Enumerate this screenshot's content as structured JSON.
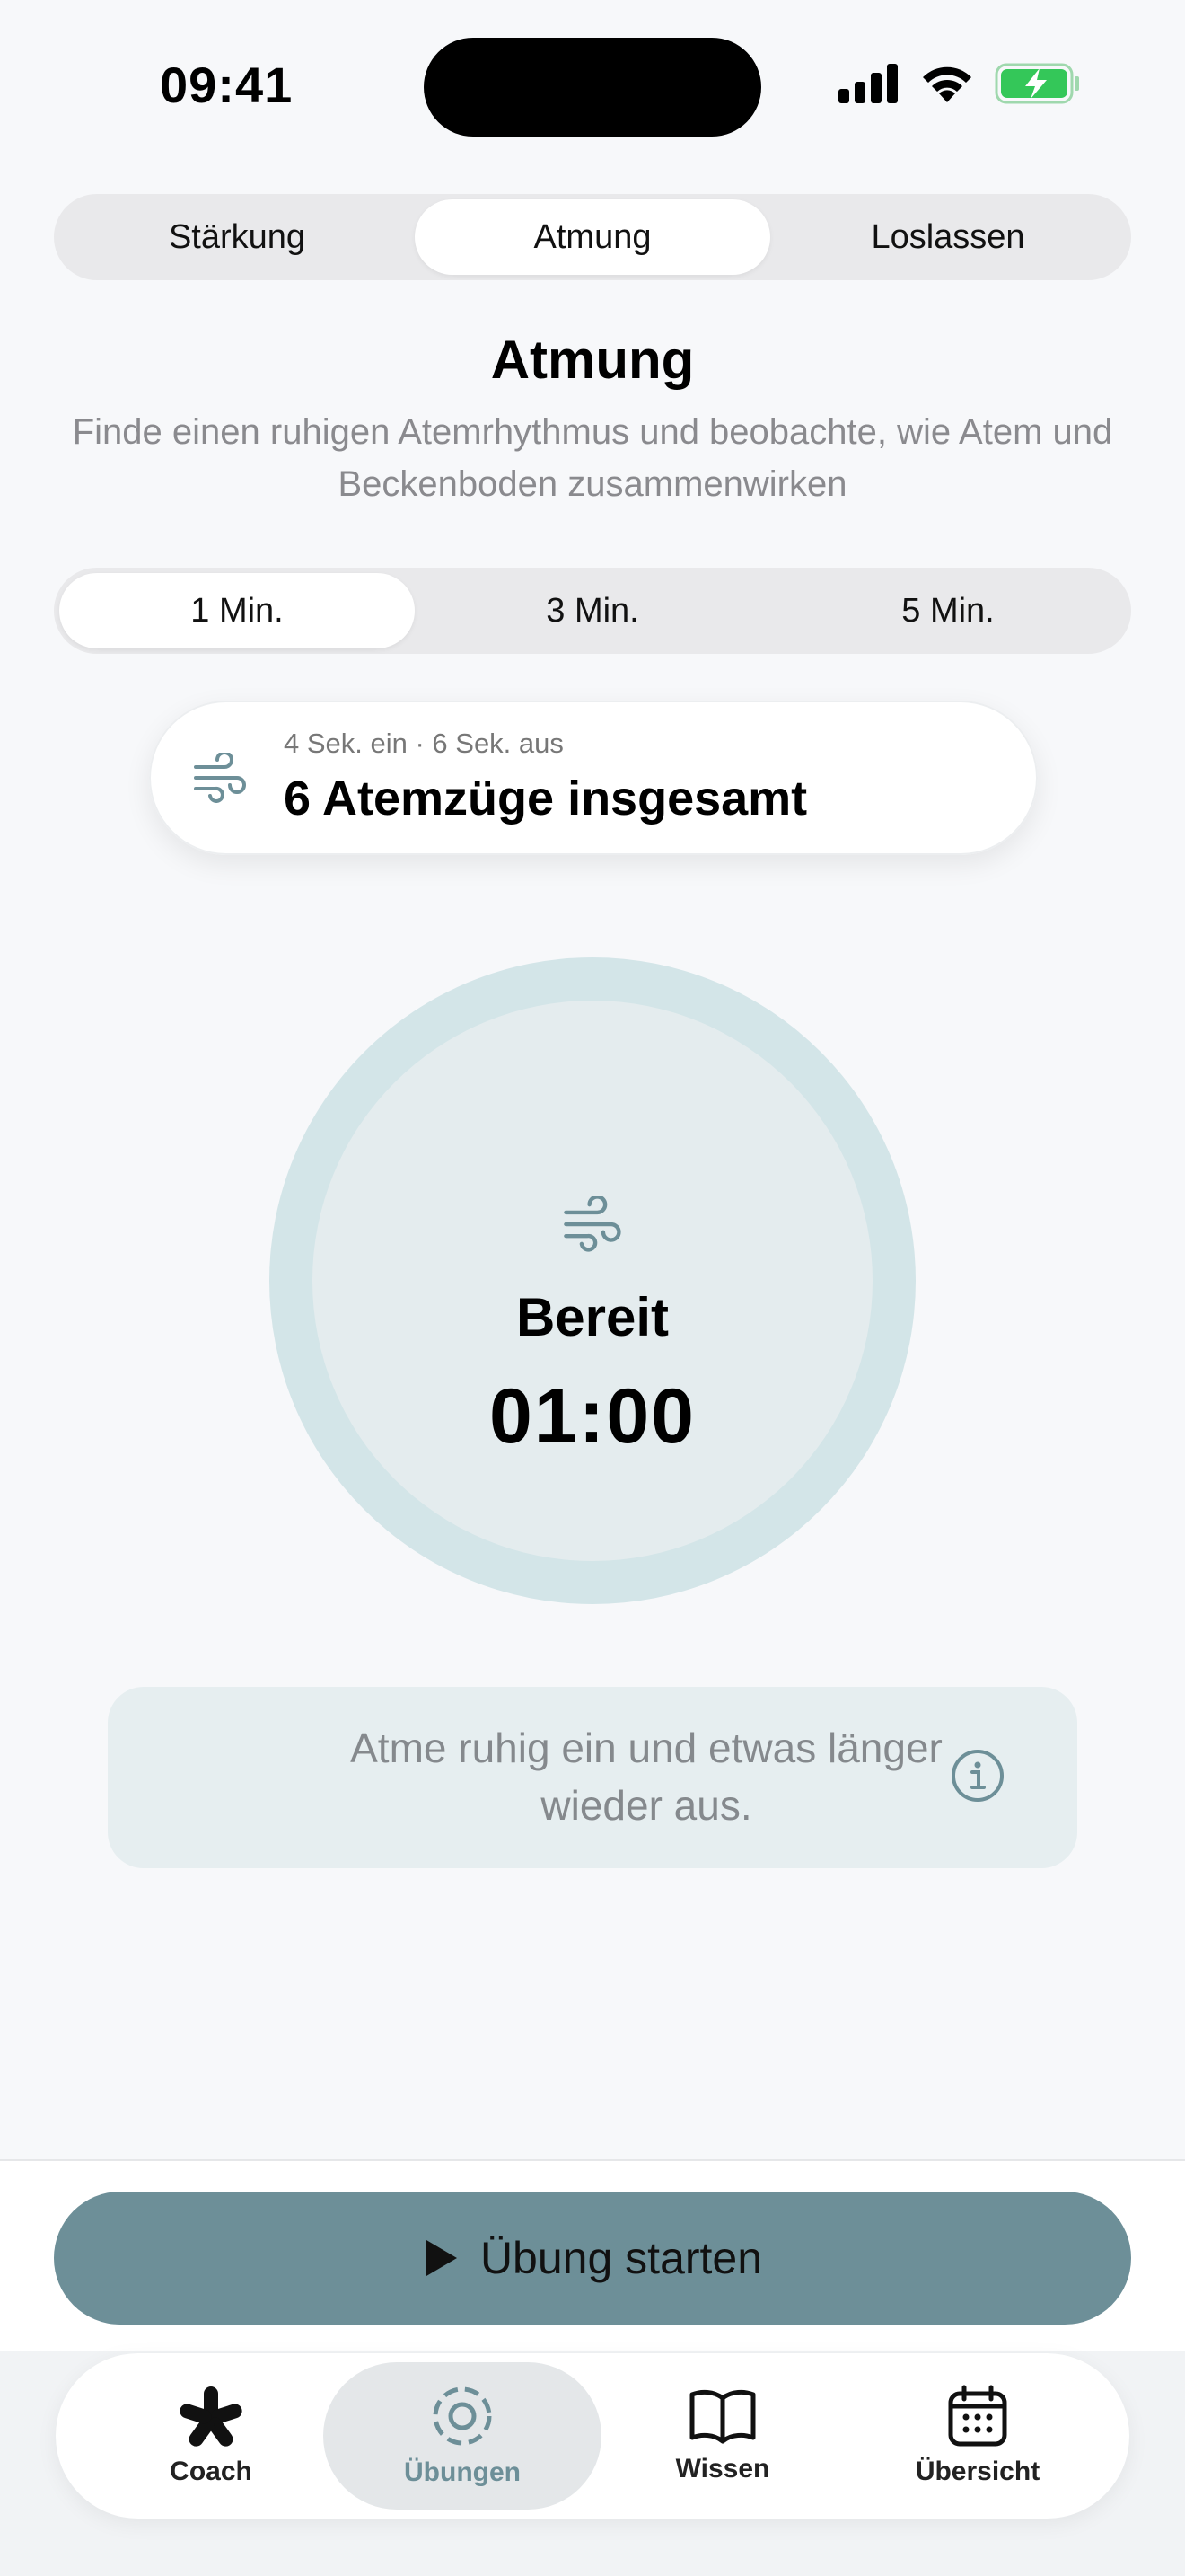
{
  "status": {
    "time": "09:41"
  },
  "category_tabs": [
    "Stärkung",
    "Atmung",
    "Loslassen"
  ],
  "title": "Atmung",
  "subtitle": "Finde einen ruhigen Atemrhythmus und beobachte, wie Atem und Beckenboden zusammenwirken",
  "duration_tabs": [
    "1 Min.",
    "3 Min.",
    "5 Min."
  ],
  "rhythm": {
    "detail": "4 Sek. ein · 6 Sek. aus",
    "total": "6 Atemzüge insgesamt"
  },
  "timer": {
    "state": "Bereit",
    "time": "01:00"
  },
  "hint": "Atme ruhig ein und etwas länger wieder aus.",
  "start_button": "Übung starten",
  "tabbar": [
    "Coach",
    "Übungen",
    "Wissen",
    "Übersicht"
  ],
  "colors": {
    "accent": "#6d8f98",
    "ring": "#d3e5e8",
    "battery": "#34c759"
  }
}
